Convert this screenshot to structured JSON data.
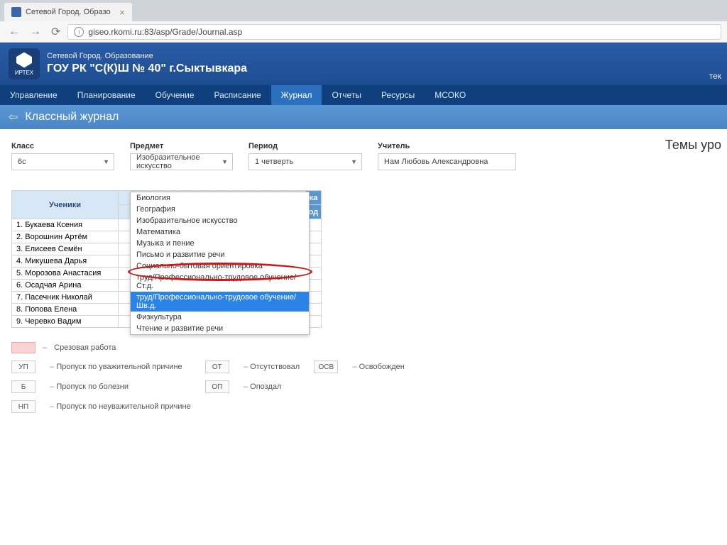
{
  "browser": {
    "tab_title": "Сетевой Город. Образо",
    "url": "giseo.rkomi.ru:83/asp/Grade/Journal.asp"
  },
  "header": {
    "system_name": "Сетевой Город. Образование",
    "school_name": "ГОУ РК \"С(К)Ш № 40\" г.Сыктывкара",
    "logo_text": "ИРТЕХ",
    "right_cut": "тек"
  },
  "nav": {
    "items": [
      "Управление",
      "Планирование",
      "Обучение",
      "Расписание",
      "Журнал",
      "Отчеты",
      "Ресурсы",
      "МСОКО"
    ],
    "active_index": 4
  },
  "page": {
    "title": "Классный журнал",
    "section_heading": "Темы уро"
  },
  "filters": {
    "class": {
      "label": "Класс",
      "value": "6c"
    },
    "subject": {
      "label": "Предмет",
      "value": "Изобразительное искусство"
    },
    "period": {
      "label": "Период",
      "value": "1 четверть"
    },
    "teacher": {
      "label": "Учитель",
      "value": "Нам Любовь Александровна"
    }
  },
  "subject_options": [
    "Биология",
    "География",
    "Изобразительное искусство",
    "Математика",
    "Музыка и пение",
    "Письмо и развитие речи",
    "Социально-бытовая ориентировка",
    "труд/Профессионально-трудовое обучение/Ст.д.",
    "труд/Профессионально-трудовое обучение/Шв.д.",
    "Физкультура",
    "Чтение и развитие речи"
  ],
  "highlighted_option_index": 8,
  "grid": {
    "students_header": "Ученики",
    "assess_stub_top": "ка",
    "assess_stub_bottom": "од",
    "students": [
      "1. Букаева Ксения",
      "2. Ворошнин Артём",
      "3. Елисеев Семён",
      "4. Микушева Дарья",
      "5. Морозова Анастасия",
      "6. Осадчая Арина",
      "7. Пасечник Николай",
      "8. Попова Елена",
      "9. Черевко Вадим"
    ]
  },
  "legend": {
    "swatch_label": "Срезовая работа",
    "codes": [
      {
        "code": "УП",
        "text": "Пропуск по уважительной причине"
      },
      {
        "code": "ОТ",
        "text": "Отсутствовал"
      },
      {
        "code": "ОСВ",
        "text": "Освобожден"
      },
      {
        "code": "Б",
        "text": "Пропуск по болезни"
      },
      {
        "code": "ОП",
        "text": "Опоздал"
      },
      {
        "code": "НП",
        "text": "Пропуск по неуважительной причине"
      }
    ]
  }
}
